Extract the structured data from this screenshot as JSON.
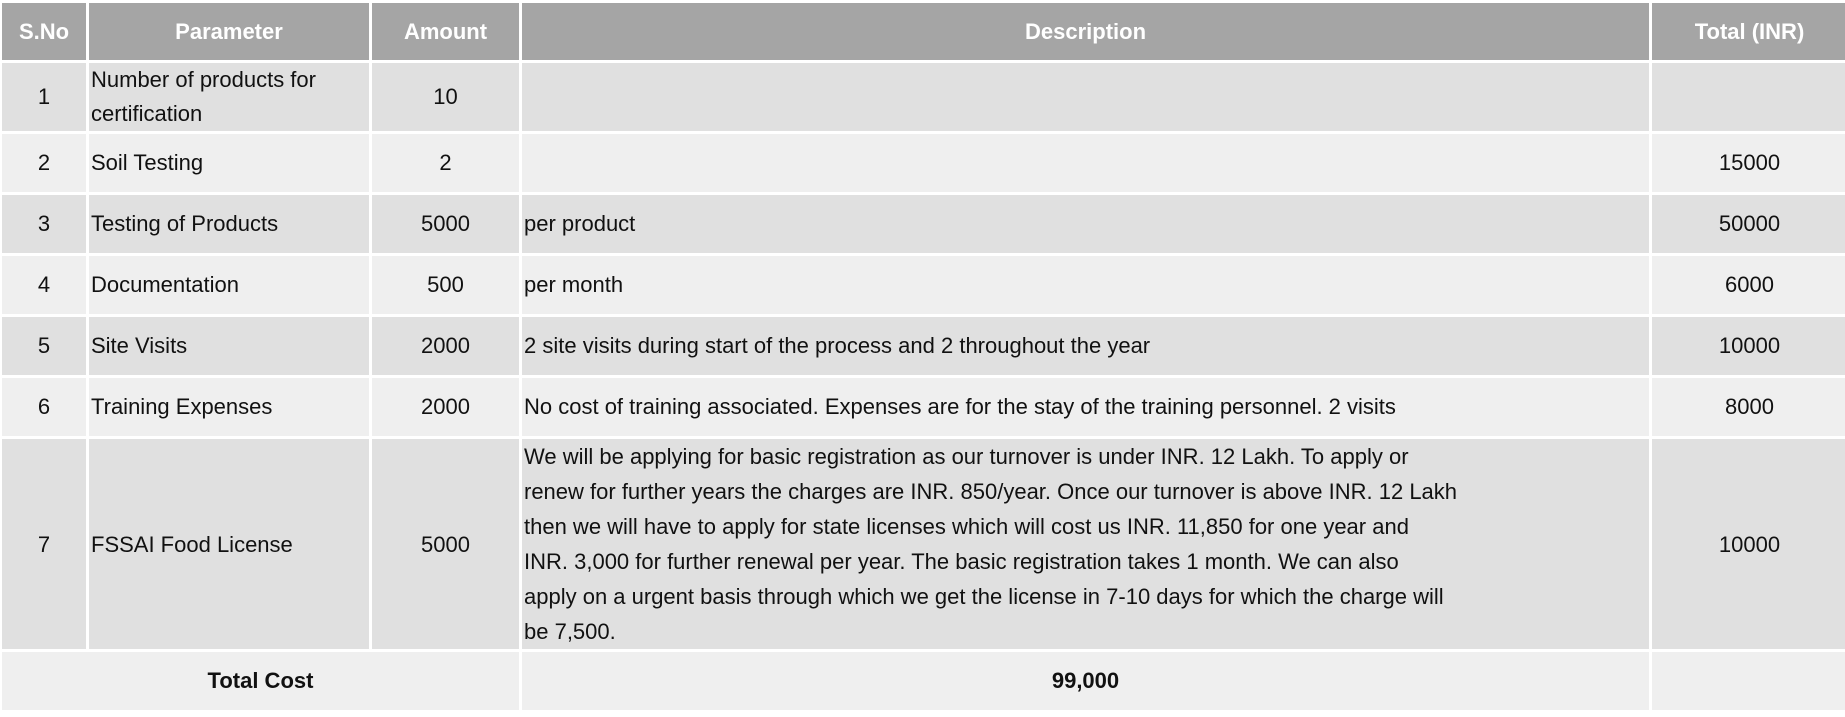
{
  "headers": [
    "S.No",
    "Parameter",
    "Amount",
    "Description",
    "Total (INR)"
  ],
  "rows": [
    {
      "sno": "1",
      "parameter": "Number of products for certification",
      "amount": "10",
      "description": "",
      "total": ""
    },
    {
      "sno": "2",
      "parameter": "Soil Testing",
      "amount": "2",
      "description": "",
      "total": "15000"
    },
    {
      "sno": "3",
      "parameter": "Testing of Products",
      "amount": "5000",
      "description": "per product",
      "total": "50000"
    },
    {
      "sno": "4",
      "parameter": "Documentation",
      "amount": "500",
      "description": "per month",
      "total": "6000"
    },
    {
      "sno": "5",
      "parameter": "Site Visits",
      "amount": "2000",
      "description": "2 site visits during start of the process and 2 throughout the year",
      "total": "10000"
    },
    {
      "sno": "6",
      "parameter": "Training Expenses",
      "amount": "2000",
      "description": "No cost of training associated. Expenses are for the stay of the training personnel. 2 visits",
      "total": "8000"
    },
    {
      "sno": "7",
      "parameter": "FSSAI Food License",
      "amount": "5000",
      "description_lines": [
        "We will be applying for basic registration as our turnover is under INR. 12 Lakh. To apply or",
        "renew for further years the charges are INR. 850/year. Once our turnover is above INR. 12 Lakh",
        "then we will have to apply for state licenses which will cost us INR. 11,850 for one year and",
        "INR. 3,000 for further renewal per year. The basic registration takes 1 month. We can also",
        "apply on a urgent basis through which we get the license in 7-10 days for which the charge will",
        "be 7,500."
      ],
      "total": "10000"
    }
  ],
  "footer": {
    "label": "Total Cost",
    "value": "99,000",
    "total": ""
  },
  "colors": {
    "header_bg": "#a5a5a5",
    "row_odd": "#e0e0e0",
    "row_even": "#efefef"
  }
}
